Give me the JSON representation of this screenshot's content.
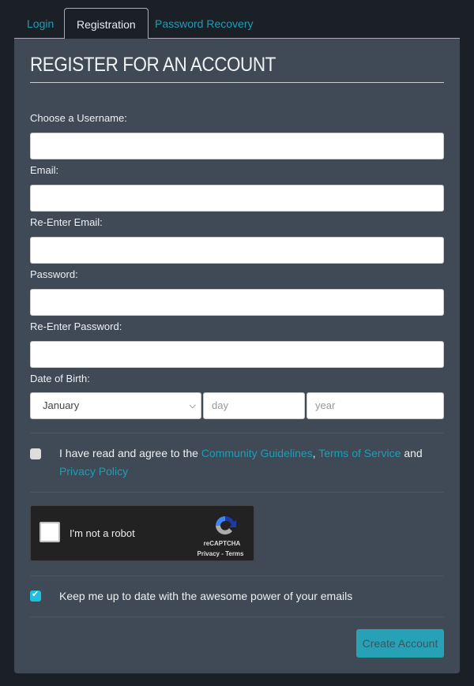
{
  "tabs": [
    {
      "label": "Login"
    },
    {
      "label": "Registration",
      "active": true
    },
    {
      "label": "Password Recovery"
    }
  ],
  "title": "REGISTER FOR AN ACCOUNT",
  "fields": {
    "username": "Choose a Username:",
    "email": "Email:",
    "email2": "Re-Enter Email:",
    "password": "Password:",
    "password2": "Re-Enter Password:",
    "dob": "Date of Birth:"
  },
  "dob": {
    "month": "January",
    "day_placeholder": "day",
    "year_placeholder": "year"
  },
  "agree": {
    "prefix": "I have read and agree to the ",
    "link1": "Community Guidelines",
    "sep": ", ",
    "link2": "Terms of Service",
    "and": " and ",
    "link3": "Privacy Policy",
    "checked": false
  },
  "captcha": {
    "label": "I'm not a robot",
    "brand": "reCAPTCHA",
    "links": "Privacy - Terms"
  },
  "newsletter": {
    "label": "Keep me up to date with the awesome power of your emails",
    "checked": true
  },
  "submit": "Create Account",
  "colors": {
    "accent": "#1f9db5",
    "panel": "#3f4a56",
    "background": "#1b1f26",
    "button": "#27a1b5"
  }
}
